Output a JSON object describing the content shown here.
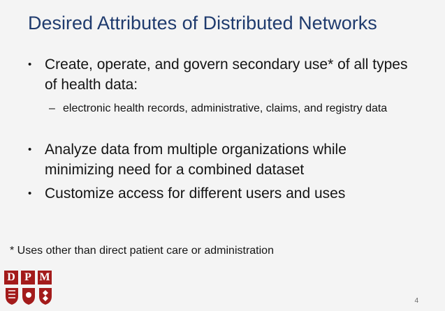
{
  "slide": {
    "title": "Desired Attributes of Distributed Networks",
    "bullets": [
      "Create, operate, and govern secondary use* of all types of health data:",
      "Analyze data from multiple organizations while minimizing need for a combined dataset",
      "Customize access for different users and uses"
    ],
    "sub_bullets": [
      "electronic health records, administrative, claims, and registry data"
    ],
    "bullet_marker": "•",
    "sub_bullet_marker": "–",
    "footnote": "* Uses other than direct patient care or administration",
    "page_number": "4",
    "logo": {
      "letters": [
        "D",
        "P",
        "M"
      ],
      "icon": "dpm-logo-icon"
    }
  },
  "colors": {
    "title": "#1f3b6e",
    "logo_red": "#a31b1b",
    "background": "#f4f4f4",
    "text": "#141414"
  }
}
